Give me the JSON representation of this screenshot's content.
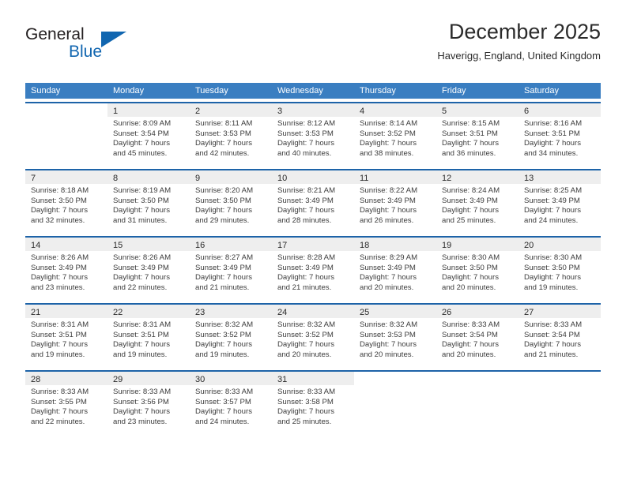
{
  "brand": {
    "name_part1": "General",
    "name_part2": "Blue",
    "accent_color": "#1166b0",
    "logo_icon": "triangle-logo-icon"
  },
  "header": {
    "title": "December 2025",
    "subtitle": "Haverigg, England, United Kingdom"
  },
  "calendar": {
    "header_bg": "#3a7ec1",
    "row_separator_color": "#1d63a8",
    "day_band_bg": "#eeeeee",
    "weekdays": [
      "Sunday",
      "Monday",
      "Tuesday",
      "Wednesday",
      "Thursday",
      "Friday",
      "Saturday"
    ],
    "weeks": [
      [
        {
          "day": "",
          "lines": []
        },
        {
          "day": "1",
          "lines": [
            "Sunrise: 8:09 AM",
            "Sunset: 3:54 PM",
            "Daylight: 7 hours",
            "and 45 minutes."
          ]
        },
        {
          "day": "2",
          "lines": [
            "Sunrise: 8:11 AM",
            "Sunset: 3:53 PM",
            "Daylight: 7 hours",
            "and 42 minutes."
          ]
        },
        {
          "day": "3",
          "lines": [
            "Sunrise: 8:12 AM",
            "Sunset: 3:53 PM",
            "Daylight: 7 hours",
            "and 40 minutes."
          ]
        },
        {
          "day": "4",
          "lines": [
            "Sunrise: 8:14 AM",
            "Sunset: 3:52 PM",
            "Daylight: 7 hours",
            "and 38 minutes."
          ]
        },
        {
          "day": "5",
          "lines": [
            "Sunrise: 8:15 AM",
            "Sunset: 3:51 PM",
            "Daylight: 7 hours",
            "and 36 minutes."
          ]
        },
        {
          "day": "6",
          "lines": [
            "Sunrise: 8:16 AM",
            "Sunset: 3:51 PM",
            "Daylight: 7 hours",
            "and 34 minutes."
          ]
        }
      ],
      [
        {
          "day": "7",
          "lines": [
            "Sunrise: 8:18 AM",
            "Sunset: 3:50 PM",
            "Daylight: 7 hours",
            "and 32 minutes."
          ]
        },
        {
          "day": "8",
          "lines": [
            "Sunrise: 8:19 AM",
            "Sunset: 3:50 PM",
            "Daylight: 7 hours",
            "and 31 minutes."
          ]
        },
        {
          "day": "9",
          "lines": [
            "Sunrise: 8:20 AM",
            "Sunset: 3:50 PM",
            "Daylight: 7 hours",
            "and 29 minutes."
          ]
        },
        {
          "day": "10",
          "lines": [
            "Sunrise: 8:21 AM",
            "Sunset: 3:49 PM",
            "Daylight: 7 hours",
            "and 28 minutes."
          ]
        },
        {
          "day": "11",
          "lines": [
            "Sunrise: 8:22 AM",
            "Sunset: 3:49 PM",
            "Daylight: 7 hours",
            "and 26 minutes."
          ]
        },
        {
          "day": "12",
          "lines": [
            "Sunrise: 8:24 AM",
            "Sunset: 3:49 PM",
            "Daylight: 7 hours",
            "and 25 minutes."
          ]
        },
        {
          "day": "13",
          "lines": [
            "Sunrise: 8:25 AM",
            "Sunset: 3:49 PM",
            "Daylight: 7 hours",
            "and 24 minutes."
          ]
        }
      ],
      [
        {
          "day": "14",
          "lines": [
            "Sunrise: 8:26 AM",
            "Sunset: 3:49 PM",
            "Daylight: 7 hours",
            "and 23 minutes."
          ]
        },
        {
          "day": "15",
          "lines": [
            "Sunrise: 8:26 AM",
            "Sunset: 3:49 PM",
            "Daylight: 7 hours",
            "and 22 minutes."
          ]
        },
        {
          "day": "16",
          "lines": [
            "Sunrise: 8:27 AM",
            "Sunset: 3:49 PM",
            "Daylight: 7 hours",
            "and 21 minutes."
          ]
        },
        {
          "day": "17",
          "lines": [
            "Sunrise: 8:28 AM",
            "Sunset: 3:49 PM",
            "Daylight: 7 hours",
            "and 21 minutes."
          ]
        },
        {
          "day": "18",
          "lines": [
            "Sunrise: 8:29 AM",
            "Sunset: 3:49 PM",
            "Daylight: 7 hours",
            "and 20 minutes."
          ]
        },
        {
          "day": "19",
          "lines": [
            "Sunrise: 8:30 AM",
            "Sunset: 3:50 PM",
            "Daylight: 7 hours",
            "and 20 minutes."
          ]
        },
        {
          "day": "20",
          "lines": [
            "Sunrise: 8:30 AM",
            "Sunset: 3:50 PM",
            "Daylight: 7 hours",
            "and 19 minutes."
          ]
        }
      ],
      [
        {
          "day": "21",
          "lines": [
            "Sunrise: 8:31 AM",
            "Sunset: 3:51 PM",
            "Daylight: 7 hours",
            "and 19 minutes."
          ]
        },
        {
          "day": "22",
          "lines": [
            "Sunrise: 8:31 AM",
            "Sunset: 3:51 PM",
            "Daylight: 7 hours",
            "and 19 minutes."
          ]
        },
        {
          "day": "23",
          "lines": [
            "Sunrise: 8:32 AM",
            "Sunset: 3:52 PM",
            "Daylight: 7 hours",
            "and 19 minutes."
          ]
        },
        {
          "day": "24",
          "lines": [
            "Sunrise: 8:32 AM",
            "Sunset: 3:52 PM",
            "Daylight: 7 hours",
            "and 20 minutes."
          ]
        },
        {
          "day": "25",
          "lines": [
            "Sunrise: 8:32 AM",
            "Sunset: 3:53 PM",
            "Daylight: 7 hours",
            "and 20 minutes."
          ]
        },
        {
          "day": "26",
          "lines": [
            "Sunrise: 8:33 AM",
            "Sunset: 3:54 PM",
            "Daylight: 7 hours",
            "and 20 minutes."
          ]
        },
        {
          "day": "27",
          "lines": [
            "Sunrise: 8:33 AM",
            "Sunset: 3:54 PM",
            "Daylight: 7 hours",
            "and 21 minutes."
          ]
        }
      ],
      [
        {
          "day": "28",
          "lines": [
            "Sunrise: 8:33 AM",
            "Sunset: 3:55 PM",
            "Daylight: 7 hours",
            "and 22 minutes."
          ]
        },
        {
          "day": "29",
          "lines": [
            "Sunrise: 8:33 AM",
            "Sunset: 3:56 PM",
            "Daylight: 7 hours",
            "and 23 minutes."
          ]
        },
        {
          "day": "30",
          "lines": [
            "Sunrise: 8:33 AM",
            "Sunset: 3:57 PM",
            "Daylight: 7 hours",
            "and 24 minutes."
          ]
        },
        {
          "day": "31",
          "lines": [
            "Sunrise: 8:33 AM",
            "Sunset: 3:58 PM",
            "Daylight: 7 hours",
            "and 25 minutes."
          ]
        },
        {
          "day": "",
          "lines": []
        },
        {
          "day": "",
          "lines": []
        },
        {
          "day": "",
          "lines": []
        }
      ]
    ]
  }
}
